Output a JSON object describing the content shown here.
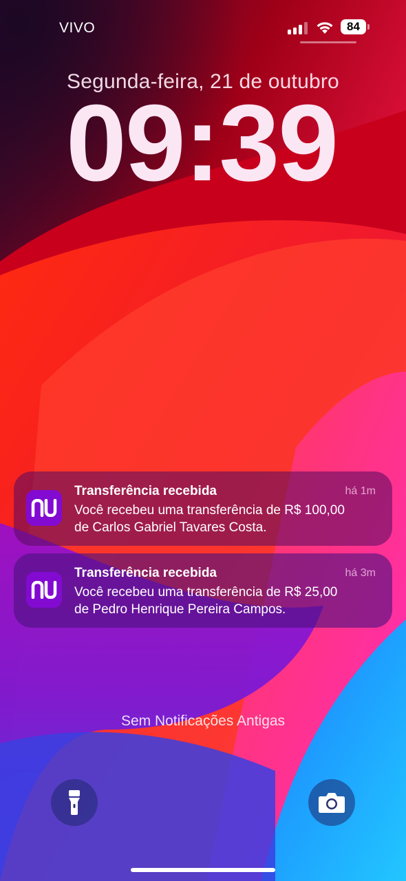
{
  "status_bar": {
    "carrier": "VIVO",
    "battery_level": "84",
    "signal_bars_active": 3,
    "signal_bars_total": 4,
    "icons": [
      "signal-icon",
      "wifi-icon",
      "battery-icon"
    ]
  },
  "lock_screen": {
    "date": "Segunda-feira, 21 de outubro",
    "time": "09:39"
  },
  "notifications": [
    {
      "app_icon": "nubank-icon",
      "app_icon_text": "nu",
      "title": "Transferência recebida",
      "time": "há 1m",
      "body_line1": "Você recebeu uma transferência de R$ 100,00",
      "body_line2": "de Carlos Gabriel Tavares Costa."
    },
    {
      "app_icon": "nubank-icon",
      "app_icon_text": "nu",
      "title": "Transferência recebida",
      "time": "há 3m",
      "body_line1": "Você recebeu uma transferência de R$ 25,00",
      "body_line2": "de Pedro Henrique Pereira Campos."
    }
  ],
  "no_older_notifications": "Sem Notificações Antigas",
  "bottom_buttons": {
    "left": "flashlight-icon",
    "right": "camera-icon"
  },
  "colors": {
    "nubank_purple": "#820ad1"
  }
}
